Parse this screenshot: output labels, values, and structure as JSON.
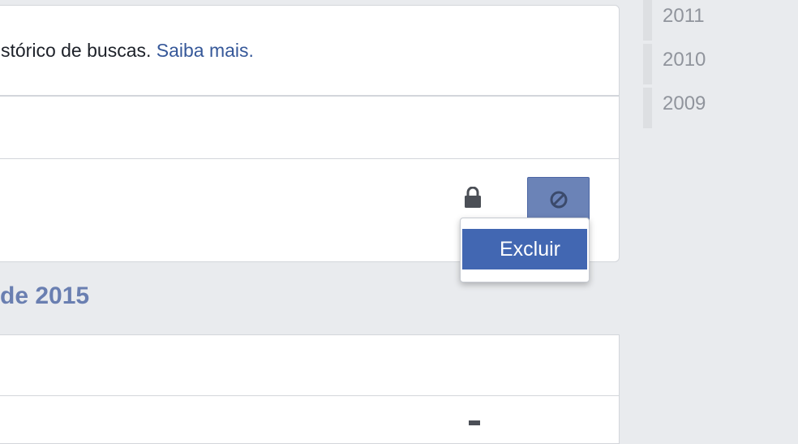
{
  "info": {
    "text": "stórico de buscas. ",
    "link": "Saiba mais."
  },
  "actions": {
    "lock_icon": "lock-icon",
    "block_icon": "block-icon",
    "menu_item": "Excluir"
  },
  "section": {
    "title": "de 2015"
  },
  "year_nav": {
    "years": [
      "2011",
      "2010",
      "2009"
    ]
  },
  "colors": {
    "accent": "#4267b2",
    "link": "#365899",
    "section_title": "#6a7fb1",
    "background": "#e9ebee"
  }
}
